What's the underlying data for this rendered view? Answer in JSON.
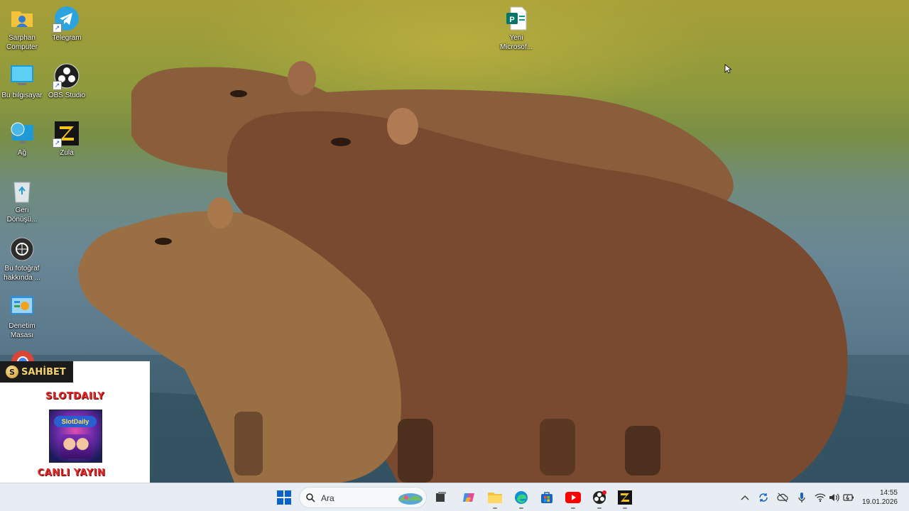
{
  "desktop": {
    "icons_left": [
      {
        "label": "Sarphan\nComputer",
        "icon": "user-folder-icon"
      },
      {
        "label": "Bu bilgisayar",
        "icon": "computer-icon"
      },
      {
        "label": "Ağ",
        "icon": "network-icon"
      },
      {
        "label": "Geri\nDönüşü...",
        "icon": "recycle-bin-icon"
      },
      {
        "label": "Bu fotoğraf\nhakkında ...",
        "icon": "about-photo-icon"
      },
      {
        "label": "Denetim\nMasası",
        "icon": "control-panel-icon"
      }
    ],
    "icons_second": [
      {
        "label": "Telegram",
        "icon": "telegram-icon"
      },
      {
        "label": "OBS Studio",
        "icon": "obs-icon"
      },
      {
        "label": "Zula",
        "icon": "zula-icon"
      }
    ],
    "icon_file": {
      "label": "Yeni\nMicrosof...",
      "icon": "publisher-file-icon"
    }
  },
  "overlay": {
    "brand": "SAHİBET",
    "coin_letter": "S",
    "title": "SLOTDAILY",
    "thumb_text": "SlotDaily",
    "subtitle": "CANLI YAYIN"
  },
  "taskbar": {
    "search_placeholder": "Ara",
    "clock_time": "14:55",
    "clock_date": "19.01.2026",
    "apps": [
      "start-icon",
      "search-icon",
      "widgets-icon",
      "task-view-icon",
      "copilot-icon",
      "file-explorer-icon",
      "edge-icon",
      "store-icon",
      "youtube-icon",
      "obs-icon",
      "zula-icon"
    ]
  },
  "colors": {
    "accent": "#0a64c8",
    "taskbar_bg": "#e7edf3",
    "ad_red": "#e02a2a",
    "brand_gold": "#f2d36b"
  }
}
